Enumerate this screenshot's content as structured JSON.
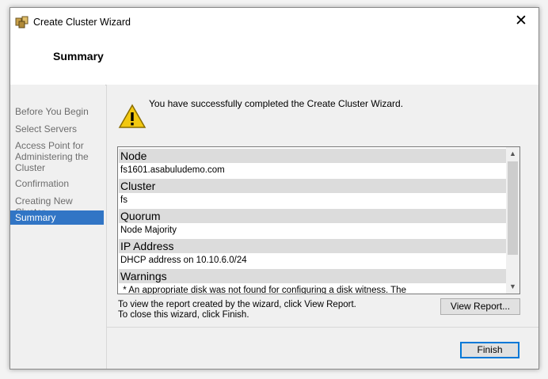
{
  "window": {
    "title": "Create Cluster Wizard",
    "close_glyph": "✕"
  },
  "header": {
    "heading": "Summary"
  },
  "steps": [
    {
      "label": "Before You Begin"
    },
    {
      "label": "Select Servers"
    },
    {
      "label": "Access Point for Administering the Cluster"
    },
    {
      "label": "Confirmation"
    },
    {
      "label": "Creating New Cluster"
    },
    {
      "label": "Summary",
      "active": true
    }
  ],
  "content": {
    "success_message": "You have successfully completed the Create Cluster Wizard.",
    "report": [
      {
        "heading": "Node",
        "value": "fs1601.asabuludemo.com"
      },
      {
        "heading": "Cluster",
        "value": "fs"
      },
      {
        "heading": "Quorum",
        "value": "Node Majority"
      },
      {
        "heading": "IP Address",
        "value": "DHCP address on 10.10.6.0/24"
      },
      {
        "heading": "Warnings",
        "value": " * An appropriate disk was not found for configuring a disk witness. The"
      }
    ],
    "info_line_1": "To view the report created by the wizard, click View Report.",
    "info_line_2": "To close this wizard, click Finish.",
    "view_report_label": "View Report...",
    "finish_label": "Finish"
  },
  "icons": {
    "app": "cluster-icon",
    "warning": "warning-icon",
    "scroll_up": "up-arrow",
    "scroll_down": "down-arrow"
  },
  "colors": {
    "selected_step": "#3175c5",
    "default_button_border": "#0078d7"
  }
}
